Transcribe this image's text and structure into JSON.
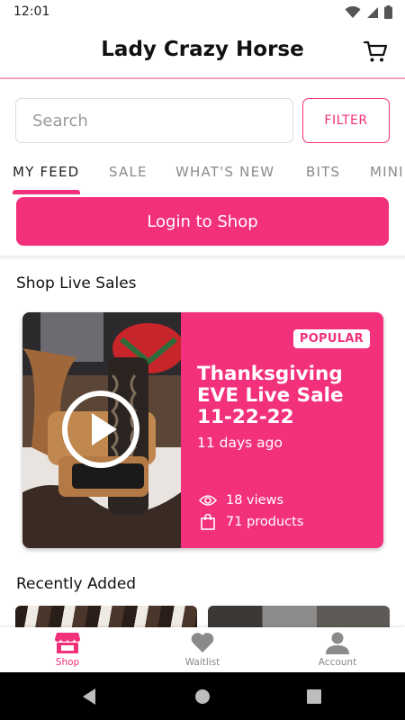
{
  "status_bar": {
    "time": "12:01"
  },
  "header": {
    "title": "Lady Crazy Horse",
    "cart_icon": "cart-icon"
  },
  "search": {
    "placeholder": "Search",
    "value": ""
  },
  "filter": {
    "label": "FILTER"
  },
  "tabs": [
    {
      "label": "MY FEED",
      "active": true
    },
    {
      "label": "SALE"
    },
    {
      "label": "WHAT'S NEW"
    },
    {
      "label": "BITS"
    },
    {
      "label": "MINI"
    }
  ],
  "login": {
    "label": "Login to Shop"
  },
  "live_sales": {
    "section_title": "Shop Live Sales",
    "card": {
      "badge": "POPULAR",
      "title": "Thanksgiving EVE Live Sale 11-22-22",
      "time_ago": "11 days ago",
      "views": "18 views",
      "products": "71 products"
    }
  },
  "recently_added": {
    "section_title": "Recently Added"
  },
  "bottom_nav": [
    {
      "label": "Shop",
      "icon": "shop-icon",
      "active": true
    },
    {
      "label": "Waitlist",
      "icon": "heart-icon"
    },
    {
      "label": "Account",
      "icon": "account-icon"
    }
  ],
  "colors": {
    "accent": "#f2307b",
    "header_border": "#f6a3c3"
  }
}
